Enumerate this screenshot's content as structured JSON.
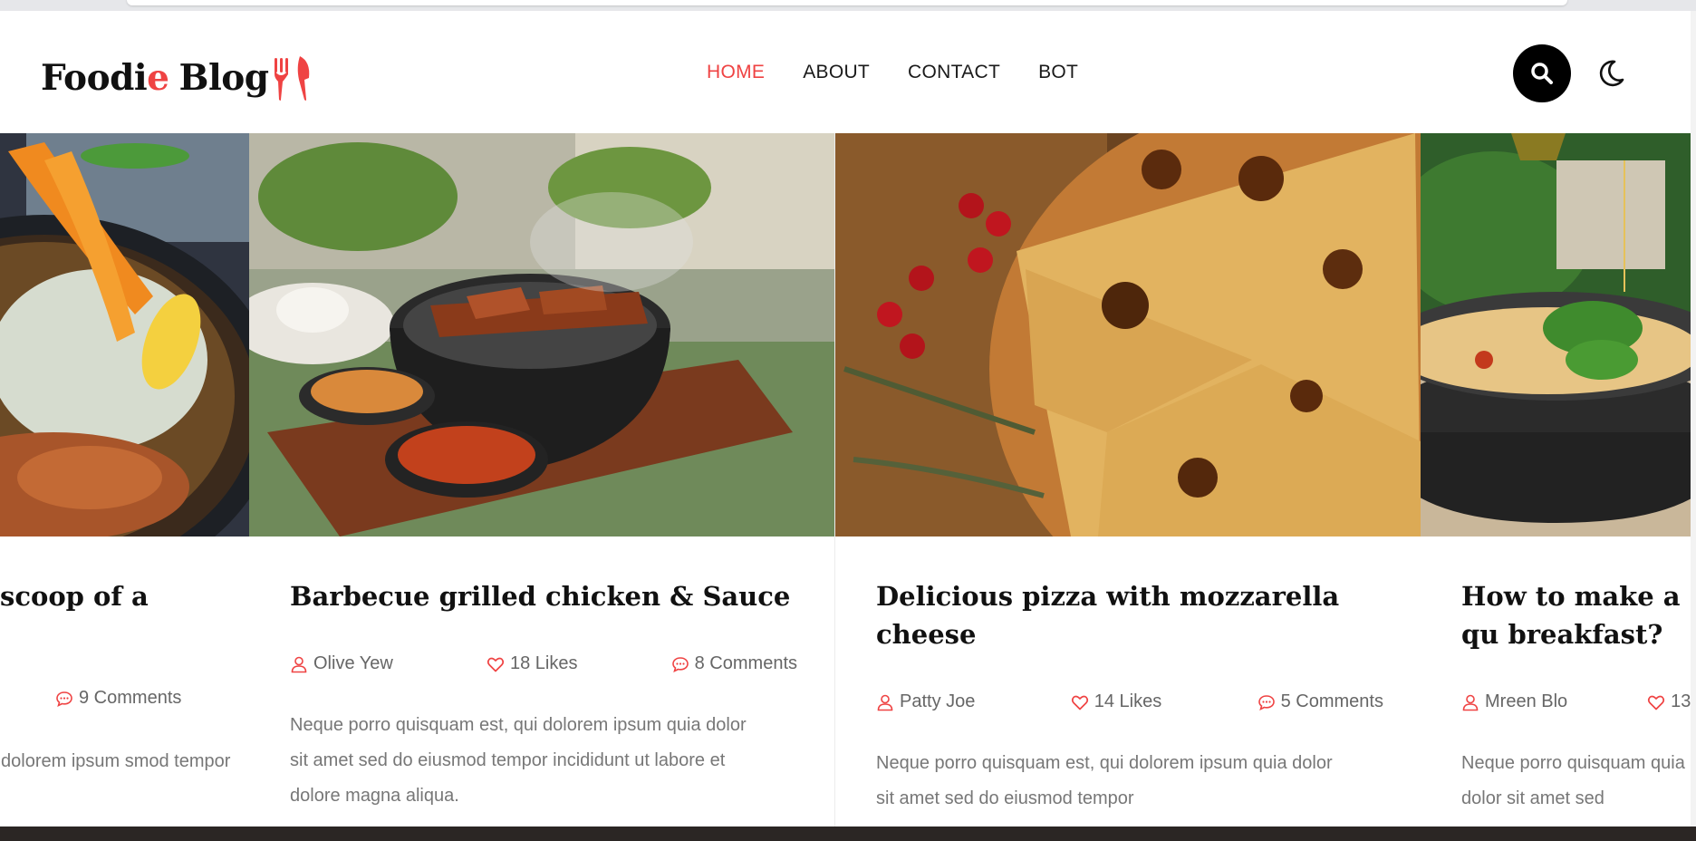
{
  "header": {
    "logo_main": "Foodi",
    "logo_accent": "e",
    "logo_tail": "Blog",
    "nav": [
      {
        "label": "HOME",
        "active": true
      },
      {
        "label": "ABOUT",
        "active": false
      },
      {
        "label": "CONTACT",
        "active": false
      },
      {
        "label": "BOT",
        "active": false
      }
    ],
    "search_icon": "search-icon",
    "theme_icon": "moon-icon"
  },
  "colors": {
    "accent": "#ef4343",
    "text_dark": "#111111",
    "text_muted": "#777777"
  },
  "cards": [
    {
      "title": "scoop of a",
      "author": "",
      "likes": "",
      "comments": "9 Comments",
      "excerpt": "i dolorem ipsum smod tempor"
    },
    {
      "title": "Barbecue grilled chicken & Sauce",
      "author": "Olive Yew",
      "likes": "18 Likes",
      "comments": "8 Comments",
      "excerpt": "Neque porro quisquam est, qui dolorem ipsum quia dolor sit amet sed do eiusmod tempor incididunt ut labore et dolore magna aliqua."
    },
    {
      "title": "Delicious pizza with mozzarella cheese",
      "author": "Patty Joe",
      "likes": "14 Likes",
      "comments": "5 Comments",
      "excerpt": "Neque porro quisquam est, qui dolorem ipsum quia dolor sit amet sed do eiusmod tempor"
    },
    {
      "title": "How to make a qu breakfast?",
      "author": "Mreen Blo",
      "likes": "13",
      "comments": "",
      "excerpt": "Neque porro quisquam quia dolor sit amet sed"
    }
  ]
}
